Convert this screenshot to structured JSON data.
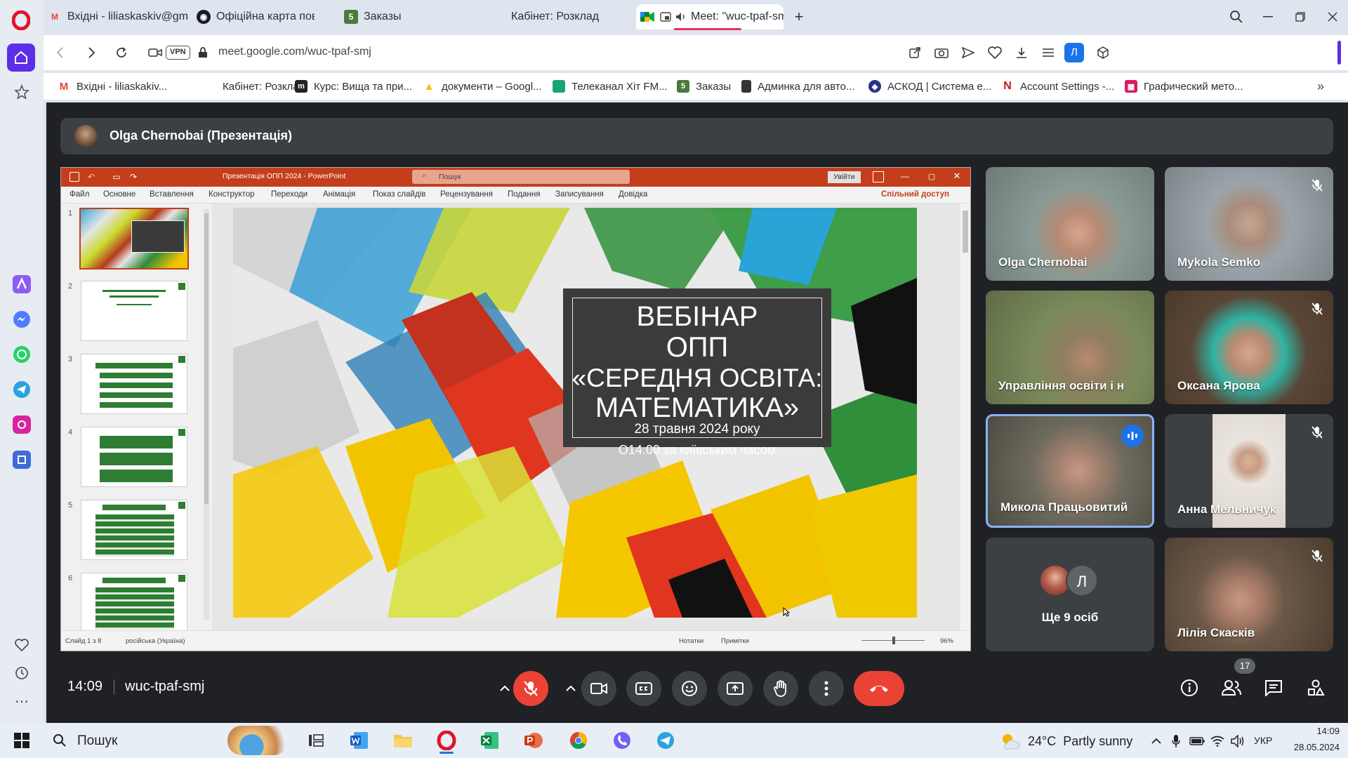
{
  "tabs": [
    {
      "title": "Вхідні - liliaskaskiv@gmail.com",
      "icon": "gmail-icon"
    },
    {
      "title": "Офіційна карта повітряних тривог",
      "icon": "alert-map-icon"
    },
    {
      "title": "Заказы",
      "icon": "orders-icon"
    },
    {
      "title": "Кабінет: Розклад",
      "icon": "cabinet-icon"
    },
    {
      "title": "Meet: \"wuc-tpaf-smj\"",
      "icon": "meet-icon"
    }
  ],
  "address": {
    "vpn": "VPN",
    "url": "meet.google.com/wuc-tpaf-smj",
    "profile": "Л"
  },
  "bookmarks": [
    {
      "label": "Вхідні - liliaskakiv...",
      "color": "#ea4335",
      "glyph": "M"
    },
    {
      "label": "Кабінет: Розклад",
      "color": "#ffffff",
      "glyph": ""
    },
    {
      "label": "Курс: Вища та при...",
      "color": "#222222",
      "glyph": "m"
    },
    {
      "label": "документи – Googl...",
      "color": "#fbbc04",
      "glyph": "▲"
    },
    {
      "label": "Телеканал Хіт FM...",
      "color": "#1aa37a",
      "glyph": ""
    },
    {
      "label": "Заказы",
      "color": "#4a7a3c",
      "glyph": "5"
    },
    {
      "label": "Админка для авто...",
      "color": "#333333",
      "glyph": ""
    },
    {
      "label": "АСКОД | Система е...",
      "color": "#2b2f8a",
      "glyph": "◆"
    },
    {
      "label": "Account Settings -...",
      "color": "#c4161c",
      "glyph": "N"
    },
    {
      "label": "Графический мето...",
      "color": "#d81b60",
      "glyph": "▦"
    }
  ],
  "presenter": {
    "label": "Olga Chernobai (Презентація)"
  },
  "ppt": {
    "title": "Презентація ОПП 2024 - PowerPoint",
    "search": "Пошук",
    "signin": "Увійти",
    "menu": [
      "Файл",
      "Основне",
      "Вставлення",
      "Конструктор",
      "Переходи",
      "Анімація",
      "Показ слайдів",
      "Рецензування",
      "Подання",
      "Записування",
      "Довідка"
    ],
    "share": "Спільний доступ",
    "slide_numbers": [
      "1",
      "2",
      "3",
      "4",
      "5",
      "6"
    ],
    "status": {
      "slide": "Слайд 1 з 8",
      "lang": "російська (Україна)",
      "notes": "Нотатки",
      "comments": "Примітки",
      "zoom": "96%"
    },
    "slide": {
      "line1": "ВЕБІНАР",
      "line2": "ОПП",
      "line3": "«СЕРЕДНЯ ОСВІТА:",
      "line4": "МАТЕМАТИКА»",
      "date": "28 травня 2024 року",
      "time": "О14.00 за київським часом"
    }
  },
  "participants": [
    {
      "name": "Olga Chernobai",
      "muted": false,
      "speaking": false,
      "bg": "#7d8b86"
    },
    {
      "name": "Mykola Semko",
      "muted": true,
      "speaking": false,
      "bg": "#9aa3a8"
    },
    {
      "name": "Управління освіти і н",
      "muted": false,
      "speaking": false,
      "bg": "#6f7a55"
    },
    {
      "name": "Оксана Ярова",
      "muted": true,
      "speaking": false,
      "bg": "#5a4636"
    },
    {
      "name": "Микола Працьовитий",
      "muted": false,
      "speaking": true,
      "bg": "#6d6a5d"
    },
    {
      "name": "Анна Мельничук",
      "muted": true,
      "speaking": false,
      "bg": "#d9d2c8"
    },
    {
      "name": "Лілія Скасків",
      "muted": true,
      "speaking": false,
      "bg": "#6b5847"
    }
  ],
  "others": {
    "label": "Ще 9 осіб",
    "avatar_letter": "Л"
  },
  "meeting": {
    "time": "14:09",
    "code": "wuc-tpaf-smj",
    "participant_count": "17"
  },
  "taskbar": {
    "search": "Пошук",
    "weather": "24°C  Partly sunny",
    "lang": "УКР",
    "time": "14:09",
    "date": "28.05.2024"
  },
  "colors": {
    "meet_bg": "#202124",
    "end_call": "#ea4335",
    "ppt_orange": "#c43e1c",
    "speaking_border": "#8ab4f8"
  }
}
